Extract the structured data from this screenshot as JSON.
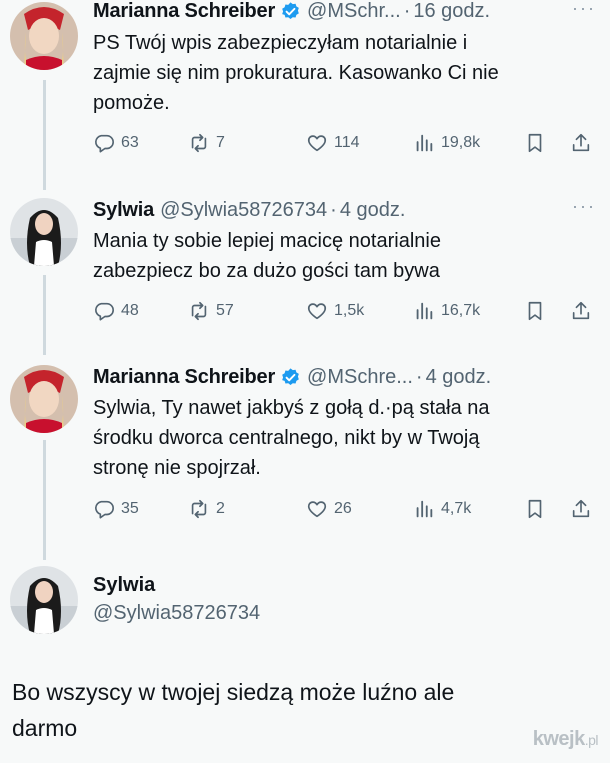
{
  "tweets": [
    {
      "name": "Marianna Schreiber",
      "verified": true,
      "handle": "@MSchr...",
      "time": "16 godz.",
      "text": "PS Twój wpis zabezpieczyłam notarialnie i\nzajmie się nim prokuratura. Kasowanko Ci nie\npomoże.",
      "replies": "63",
      "retweets": "7",
      "likes": "114",
      "views": "19,8k"
    },
    {
      "name": "Sylwia",
      "verified": false,
      "handle": "@Sylwia58726734",
      "time": "4 godz.",
      "text": "Mania ty sobie lepiej macicę notarialnie\nzabezpiecz bo za dużo gości tam bywa",
      "replies": "48",
      "retweets": "57",
      "likes": "1,5k",
      "views": "16,7k"
    },
    {
      "name": "Marianna Schreiber",
      "verified": true,
      "handle": "@MSchre...",
      "time": "4 godz.",
      "text": "Sylwia, Ty nawet jakbyś z gołą d.·pą stała na\nśrodku dworca centralnego, nikt by w Twoją\nstronę nie spojrzał.",
      "replies": "35",
      "retweets": "2",
      "likes": "26",
      "views": "4,7k"
    }
  ],
  "focused": {
    "name": "Sylwia",
    "handle": "@Sylwia58726734",
    "text": "Bo wszyscy w twojej siedzą może luźno ale\ndarmo"
  },
  "more_icon": "···",
  "separator": "·",
  "watermark": {
    "main": "kwejk",
    "suffix": ".pl"
  },
  "colors": {
    "background": "#f7f9f9",
    "text": "#0f1419",
    "secondary": "#536471",
    "verified": "#1d9bf0",
    "thread_line": "#cfd9de"
  },
  "icons": {
    "reply": "reply-icon",
    "retweet": "retweet-icon",
    "like": "heart-icon",
    "views": "views-icon",
    "bookmark": "bookmark-icon",
    "share": "share-icon",
    "verified": "verified-badge-icon"
  }
}
